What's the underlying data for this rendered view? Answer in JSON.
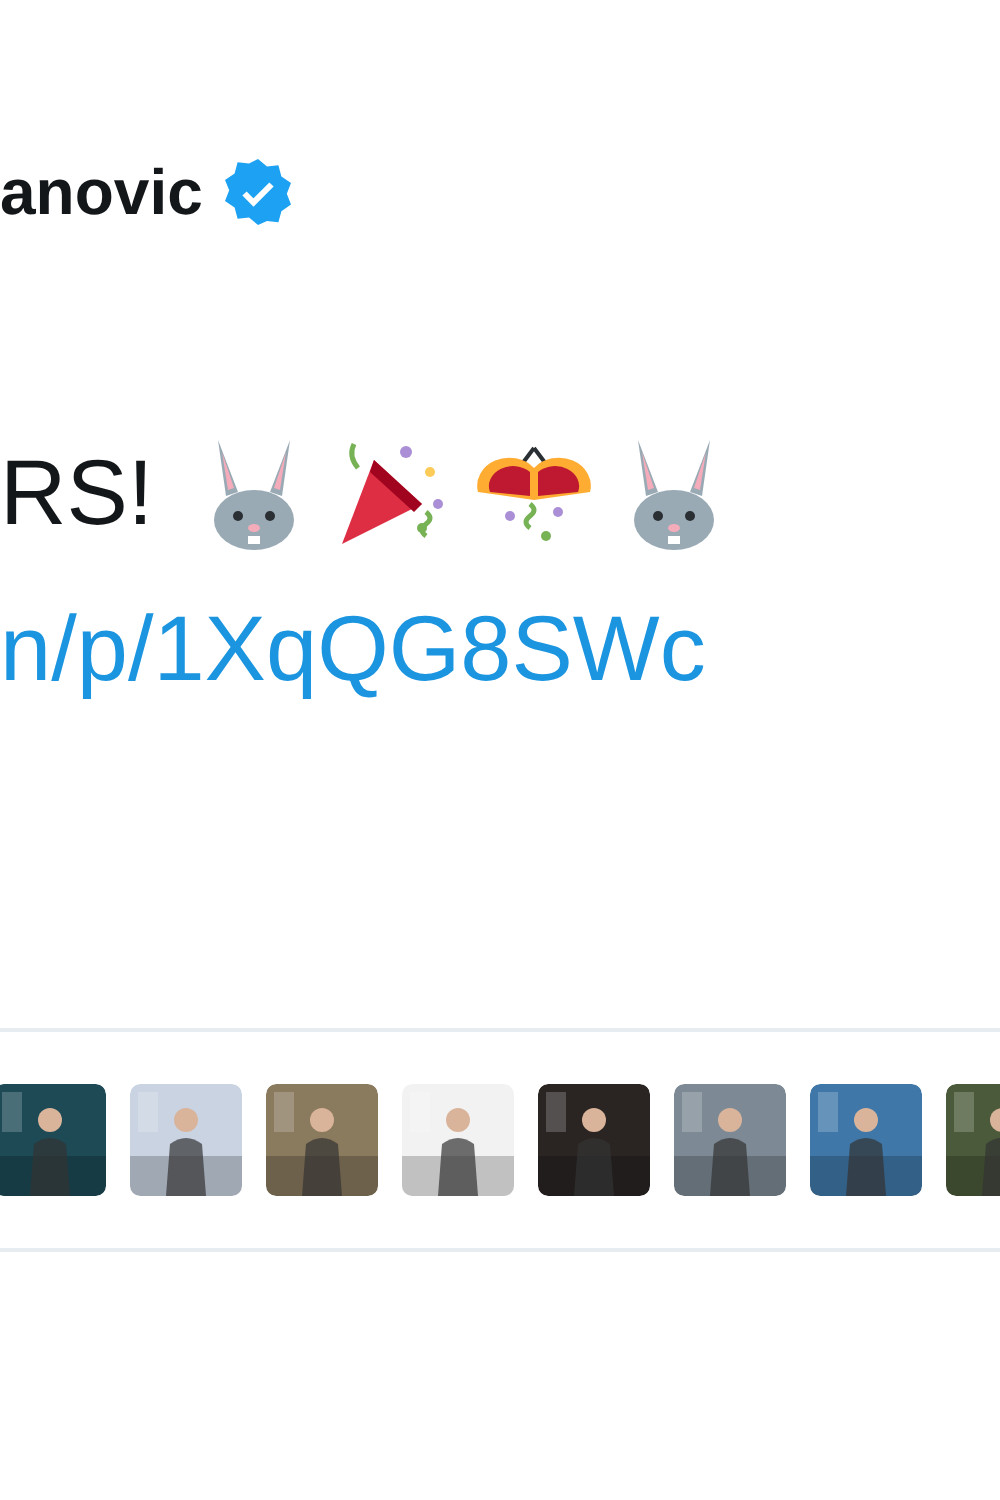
{
  "author": {
    "name": "anovic",
    "verified": true
  },
  "tweet": {
    "text": "RS!",
    "emojis": [
      {
        "kind": "rabbit"
      },
      {
        "kind": "popper"
      },
      {
        "kind": "confetti"
      },
      {
        "kind": "rabbit"
      }
    ],
    "link": "n/p/1XqQG8SWc"
  }
}
